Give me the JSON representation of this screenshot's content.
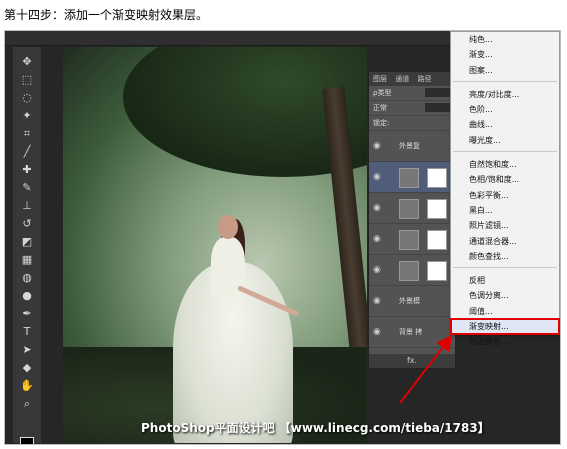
{
  "caption": "第十四步：添加一个渐变映射效果层。",
  "watermark": "PhotoShop平面设计吧 【www.linecg.com/tieba/1783】",
  "toolbar": {
    "tools": [
      "move-icon",
      "marquee-icon",
      "lasso-icon",
      "magic-wand-icon",
      "crop-icon",
      "eyedropper-icon",
      "healing-icon",
      "brush-icon",
      "stamp-icon",
      "history-brush-icon",
      "eraser-icon",
      "gradient-icon",
      "blur-icon",
      "dodge-icon",
      "pen-icon",
      "type-icon",
      "path-select-icon",
      "shape-icon",
      "hand-icon",
      "zoom-icon"
    ]
  },
  "layers_panel": {
    "tabs": [
      "图层",
      "通道",
      "路径"
    ],
    "filter_label": "ρ类型",
    "blend_mode": "正常",
    "lock_label": "锁定:",
    "group_label": "外景复",
    "layer_group_2": "外景模",
    "background_label": "背景 拷",
    "footer_icons": "fx."
  },
  "adjust_menu": {
    "items": [
      "纯色...",
      "渐变...",
      "图案...",
      "亮度/对比度...",
      "色阶...",
      "曲线...",
      "曝光度...",
      "自然饱和度...",
      "色相/饱和度...",
      "色彩平衡...",
      "黑白...",
      "照片滤镜...",
      "通道混合器...",
      "颜色查找...",
      "反相",
      "色调分离...",
      "阈值...",
      "渐变映射...",
      "可选颜色..."
    ],
    "highlight_color": "#e00000"
  }
}
